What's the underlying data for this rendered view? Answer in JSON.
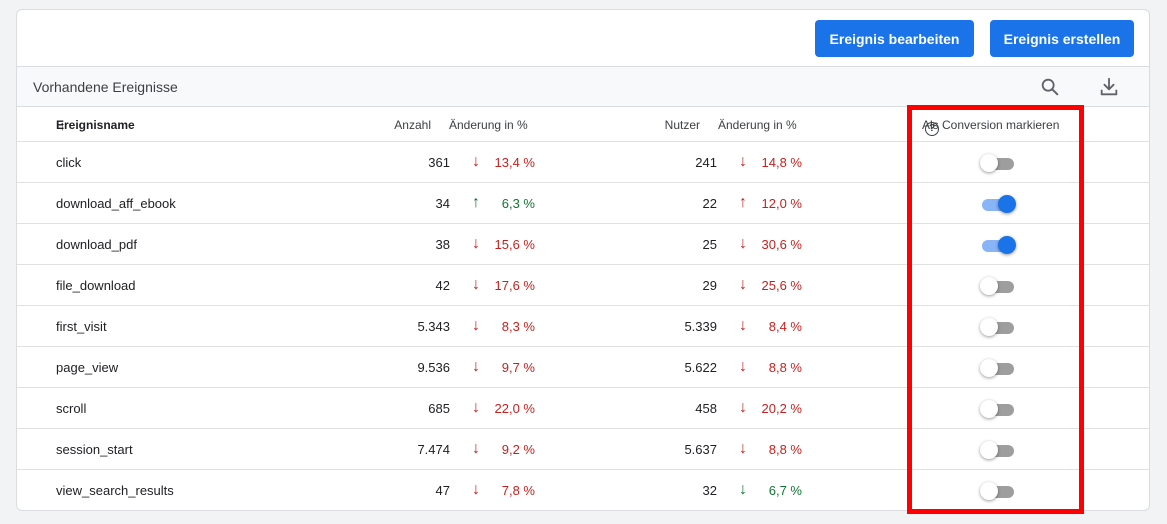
{
  "toolbar": {
    "edit_label": "Ereignis bearbeiten",
    "create_label": "Ereignis erstellen"
  },
  "section": {
    "title": "Vorhandene Ereignisse",
    "search_icon": "search-icon",
    "download_icon": "download-icon"
  },
  "headers": {
    "name": "Ereignisname",
    "sort_arrow": "↑",
    "count": "Anzahl",
    "change_count": "Änderung in %",
    "users": "Nutzer",
    "change_users": "Änderung in %",
    "conversion": "Als Conversion markieren",
    "help": "?"
  },
  "colors": {
    "accent": "#1a73e8",
    "down": "#c5221f",
    "up": "#137333",
    "highlight": "#ff0000"
  },
  "rows": [
    {
      "name": "click",
      "count": "361",
      "count_dir": "down",
      "count_pct": "13,4 %",
      "users": "241",
      "users_dir": "down",
      "users_pct": "14,8 %",
      "conversion": false
    },
    {
      "name": "download_aff_ebook",
      "count": "34",
      "count_dir": "up",
      "count_pct": "6,3 %",
      "users": "22",
      "users_dir": "up-red",
      "users_pct": "12,0 %",
      "conversion": true
    },
    {
      "name": "download_pdf",
      "count": "38",
      "count_dir": "down",
      "count_pct": "15,6 %",
      "users": "25",
      "users_dir": "down",
      "users_pct": "30,6 %",
      "conversion": true
    },
    {
      "name": "file_download",
      "count": "42",
      "count_dir": "down",
      "count_pct": "17,6 %",
      "users": "29",
      "users_dir": "down",
      "users_pct": "25,6 %",
      "conversion": false
    },
    {
      "name": "first_visit",
      "count": "5.343",
      "count_dir": "down",
      "count_pct": "8,3 %",
      "users": "5.339",
      "users_dir": "down",
      "users_pct": "8,4 %",
      "conversion": false
    },
    {
      "name": "page_view",
      "count": "9.536",
      "count_dir": "down",
      "count_pct": "9,7 %",
      "users": "5.622",
      "users_dir": "down",
      "users_pct": "8,8 %",
      "conversion": false
    },
    {
      "name": "scroll",
      "count": "685",
      "count_dir": "down",
      "count_pct": "22,0 %",
      "users": "458",
      "users_dir": "down",
      "users_pct": "20,2 %",
      "conversion": false
    },
    {
      "name": "session_start",
      "count": "7.474",
      "count_dir": "down",
      "count_pct": "9,2 %",
      "users": "5.637",
      "users_dir": "down",
      "users_pct": "8,8 %",
      "conversion": false
    },
    {
      "name": "view_search_results",
      "count": "47",
      "count_dir": "down",
      "count_pct": "7,8 %",
      "users": "32",
      "users_dir": "up-green-down",
      "users_pct": "6,7 %",
      "conversion": false
    }
  ]
}
